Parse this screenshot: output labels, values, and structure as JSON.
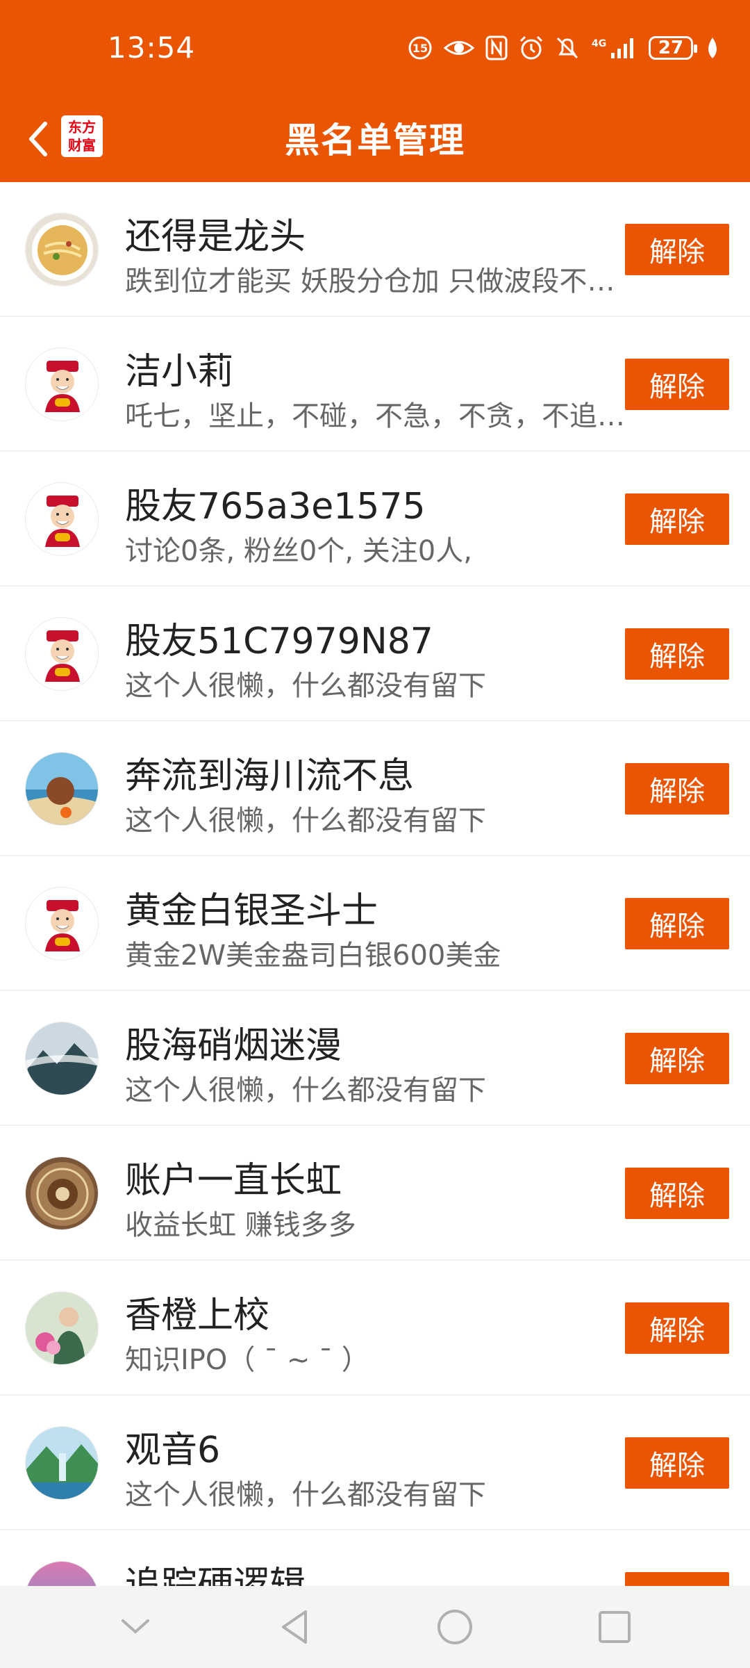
{
  "status_bar": {
    "time": "13:54",
    "network": "4G",
    "battery": "27",
    "icons": [
      "data-saver-icon",
      "eye-icon",
      "nfc-icon",
      "alarm-icon",
      "mute-icon",
      "signal-icon",
      "battery-icon",
      "leaf-icon"
    ]
  },
  "header": {
    "title": "黑名单管理",
    "back_icon": "chevron-left-icon",
    "logo_line1": "东方",
    "logo_line2": "财富"
  },
  "colors": {
    "accent": "#ea5504",
    "text_primary": "#222222",
    "text_secondary": "#666666"
  },
  "blacklist": [
    {
      "name": "还得是龙头",
      "bio": "跌到位才能买  妖股分仓加 只做波段不做长线",
      "avatar": "noodles-avatar",
      "button": "解除"
    },
    {
      "name": "洁小莉",
      "bio": "吒七，坚止，不碰，不急，不贪，不追，不慌",
      "avatar": "caishen-avatar",
      "button": "解除"
    },
    {
      "name": "股友765a3e1575",
      "bio": "讨论0条, 粉丝0个, 关注0人,",
      "avatar": "caishen-avatar",
      "button": "解除"
    },
    {
      "name": "股友51C7979N87",
      "bio": "这个人很懒，什么都没有留下",
      "avatar": "caishen-avatar",
      "button": "解除"
    },
    {
      "name": "奔流到海川流不息",
      "bio": "这个人很懒，什么都没有留下",
      "avatar": "beach-avatar",
      "button": "解除"
    },
    {
      "name": "黄金白银圣斗士",
      "bio": "黄金2W美金盎司白银600美金",
      "avatar": "caishen-avatar",
      "button": "解除"
    },
    {
      "name": "股海硝烟迷漫",
      "bio": "这个人很懒，什么都没有留下",
      "avatar": "mountain-avatar",
      "button": "解除"
    },
    {
      "name": "账户一直长虹",
      "bio": "收益长虹 赚钱多多",
      "avatar": "coin-avatar",
      "button": "解除"
    },
    {
      "name": "香橙上校",
      "bio": "知识IPO（ ¯ ~ ¯ ）",
      "avatar": "woman-flowers-avatar",
      "button": "解除"
    },
    {
      "name": "观音6",
      "bio": "这个人很懒，什么都没有留下",
      "avatar": "landscape-avatar",
      "button": "解除"
    },
    {
      "name": "追踪硬逻辑",
      "bio": "",
      "avatar": "sunset-avatar",
      "button": "解除"
    }
  ],
  "nav_bar": {
    "buttons": [
      "hide-keyboard-icon",
      "back-triangle-icon",
      "home-circle-icon",
      "recents-square-icon"
    ]
  }
}
